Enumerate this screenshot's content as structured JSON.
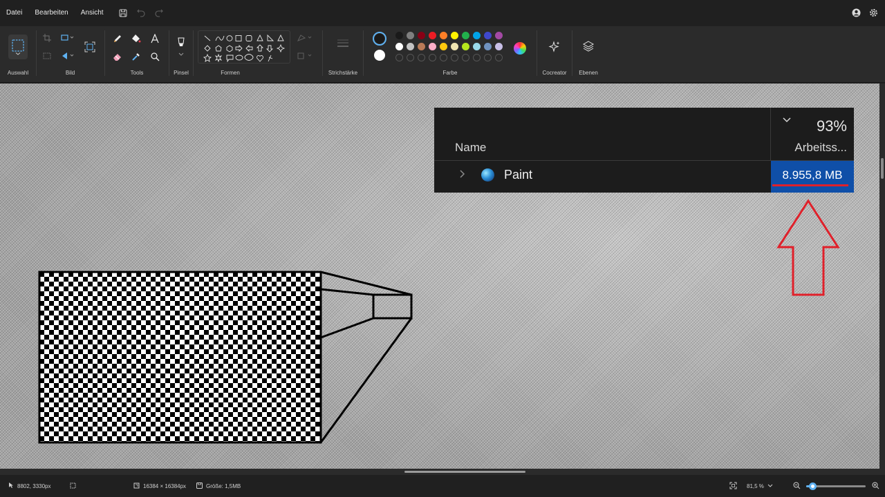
{
  "menu": {
    "items": [
      "Datei",
      "Bearbeiten",
      "Ansicht"
    ]
  },
  "ribbon": {
    "groups": {
      "auswahl": "Auswahl",
      "bild": "Bild",
      "tools": "Tools",
      "pinsel": "Pinsel",
      "formen": "Formen",
      "strichstaerke": "Strichstärke",
      "farbe": "Farbe",
      "cocreator": "Cocreator",
      "ebenen": "Ebenen"
    },
    "palette": {
      "row1": [
        "#1a1a1a",
        "#7f7f7f",
        "#880015",
        "#ed1c24",
        "#ff7f27",
        "#fff200",
        "#22b14c",
        "#00a2e8",
        "#3f48cc",
        "#a349a4"
      ],
      "row2": [
        "#ffffff",
        "#c3c3c3",
        "#b97a57",
        "#ffaec9",
        "#ffc90e",
        "#efe4b0",
        "#b5e61d",
        "#99d9ea",
        "#7092be",
        "#c8bfe7"
      ],
      "row3_empty": 10
    }
  },
  "task_manager": {
    "sort_percent": "93%",
    "col_name": "Name",
    "col_memory": "Arbeitss...",
    "app_name": "Paint",
    "memory_value": "8.955,8 MB"
  },
  "status": {
    "cursor": "8802, 3330px",
    "canvas_size": "16384 × 16384px",
    "file_size": "Größe: 1,5MB",
    "zoom": "81,5 %",
    "zoom_level_fraction": 0.1
  },
  "colors": {
    "accent_blue": "#0f4fa8",
    "arrow_red": "#e0202a"
  }
}
